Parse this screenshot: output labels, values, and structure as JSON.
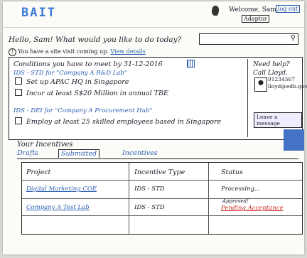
{
  "header": {
    "logo": "BAIT",
    "welcome": "Welcome, Sam.",
    "logout_label": "log out",
    "role_label": "Adaptor"
  },
  "greeting": "Hello, Sam! What would you like to do today?",
  "search": {
    "placeholder": "",
    "icon": "search-icon"
  },
  "notice": {
    "text": "You have a site visit coming up.",
    "link": "View details"
  },
  "conditions": {
    "title": "Conditions you have to meet by 31-12-2016",
    "groups": [
      {
        "label": "IDS - STD for \"Company A R&D Lab\"",
        "items": [
          "Set up APAC HQ in Singapore",
          "Incur at least S$20 Million in annual TBE"
        ]
      },
      {
        "label": "IDS - DEI for \"Company A Procurement Hub\"",
        "items": [
          "Employ at least 25 skilled employees based in Singapore"
        ]
      }
    ]
  },
  "help": {
    "title": "Need help?",
    "call": "Call Lloyd.",
    "phone": "91234567",
    "email": "lloyd@edb.gov.sg",
    "leave_label": "Leave a message"
  },
  "incentives": {
    "title": "Your Incentives",
    "tabs": [
      "Drafts",
      "Submitted",
      "Incentives"
    ],
    "active_tab": "Submitted",
    "columns": [
      "Project",
      "Incentive Type",
      "Status"
    ],
    "rows": [
      {
        "project": "Digital Marketing COE",
        "type": "IDS - STD",
        "status": "Processing...",
        "status_note": ""
      },
      {
        "project": "Company A Test Lab",
        "type": "IDS - STD",
        "status": "Pending Acceptance",
        "status_note": "Approved!"
      }
    ]
  },
  "colors": {
    "accent": "#2a5db0",
    "blue_square": "#4472c4",
    "pending": "#cc2222"
  }
}
